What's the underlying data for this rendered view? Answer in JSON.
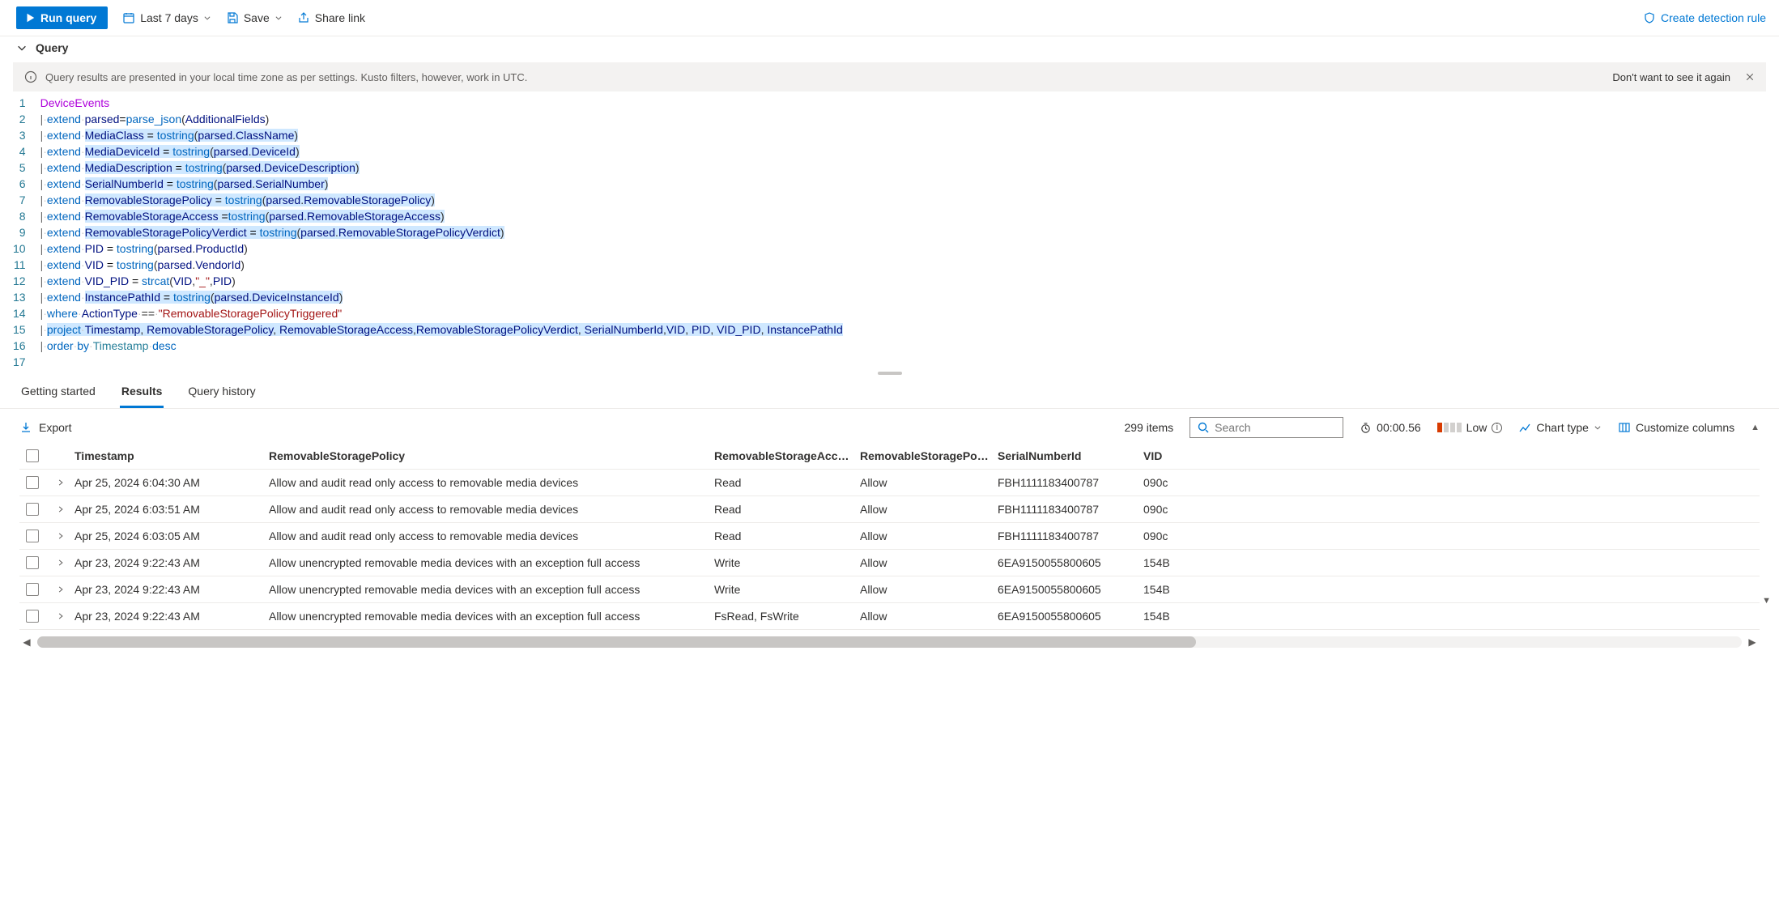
{
  "toolbar": {
    "run_label": "Run query",
    "time_label": "Last 7 days",
    "save_label": "Save",
    "share_label": "Share link",
    "create_rule_label": "Create detection rule"
  },
  "section": {
    "title": "Query"
  },
  "infobar": {
    "text": "Query results are presented in your local time zone as per settings. Kusto filters, however, work in UTC.",
    "dismiss": "Don't want to see it again"
  },
  "editor": {
    "lines": [
      {
        "n": "1",
        "raw": "DeviceEvents",
        "type": "ent"
      },
      {
        "n": "2",
        "raw": "| extend parsed=parse_json(AdditionalFields)"
      },
      {
        "n": "3",
        "raw": "| extend MediaClass = tostring(parsed.ClassName)"
      },
      {
        "n": "4",
        "raw": "| extend MediaDeviceId = tostring(parsed.DeviceId)"
      },
      {
        "n": "5",
        "raw": "| extend MediaDescription = tostring(parsed.DeviceDescription)"
      },
      {
        "n": "6",
        "raw": "| extend SerialNumberId = tostring(parsed.SerialNumber)"
      },
      {
        "n": "7",
        "raw": "| extend RemovableStoragePolicy = tostring(parsed.RemovableStoragePolicy)"
      },
      {
        "n": "8",
        "raw": "| extend RemovableStorageAccess =tostring(parsed.RemovableStorageAccess)"
      },
      {
        "n": "9",
        "raw": "| extend RemovableStoragePolicyVerdict = tostring(parsed.RemovableStoragePolicyVerdict)"
      },
      {
        "n": "10",
        "raw": "| extend PID = tostring(parsed.ProductId)"
      },
      {
        "n": "11",
        "raw": "| extend VID = tostring(parsed.VendorId)"
      },
      {
        "n": "12",
        "raw": "| extend VID_PID = strcat(VID,\"_\",PID)"
      },
      {
        "n": "13",
        "raw": "| extend InstancePathId = tostring(parsed.DeviceInstanceId)"
      },
      {
        "n": "14",
        "raw": "| where ActionType == \"RemovableStoragePolicyTriggered\""
      },
      {
        "n": "15",
        "raw": "| project Timestamp, RemovableStoragePolicy, RemovableStorageAccess,RemovableStoragePolicyVerdict, SerialNumberId,VID, PID, VID_PID, InstancePathId"
      },
      {
        "n": "16",
        "raw": "| order by Timestamp desc"
      },
      {
        "n": "17",
        "raw": ""
      }
    ]
  },
  "tabs": {
    "getting_started": "Getting started",
    "results": "Results",
    "history": "Query history"
  },
  "results": {
    "export": "Export",
    "count": "299 items",
    "search_placeholder": "Search",
    "duration": "00:00.56",
    "perf": "Low",
    "chart_type": "Chart type",
    "customize": "Customize columns",
    "columns": {
      "timestamp": "Timestamp",
      "policy": "RemovableStoragePolicy",
      "access": "RemovableStorageAccess",
      "verdict": "RemovableStoragePolicyVer...",
      "serial": "SerialNumberId",
      "vid": "VID"
    },
    "rows": [
      {
        "ts": "Apr 25, 2024 6:04:30 AM",
        "pol": "Allow and audit read only access to removable media devices",
        "acc": "Read",
        "ver": "Allow",
        "ser": "FBH1111183400787",
        "vid": "090c"
      },
      {
        "ts": "Apr 25, 2024 6:03:51 AM",
        "pol": "Allow and audit read only access to removable media devices",
        "acc": "Read",
        "ver": "Allow",
        "ser": "FBH1111183400787",
        "vid": "090c"
      },
      {
        "ts": "Apr 25, 2024 6:03:05 AM",
        "pol": "Allow and audit read only access to removable media devices",
        "acc": "Read",
        "ver": "Allow",
        "ser": "FBH1111183400787",
        "vid": "090c"
      },
      {
        "ts": "Apr 23, 2024 9:22:43 AM",
        "pol": "Allow unencrypted removable media devices with an exception full access",
        "acc": "Write",
        "ver": "Allow",
        "ser": "6EA9150055800605",
        "vid": "154B"
      },
      {
        "ts": "Apr 23, 2024 9:22:43 AM",
        "pol": "Allow unencrypted removable media devices with an exception full access",
        "acc": "Write",
        "ver": "Allow",
        "ser": "6EA9150055800605",
        "vid": "154B"
      },
      {
        "ts": "Apr 23, 2024 9:22:43 AM",
        "pol": "Allow unencrypted removable media devices with an exception full access",
        "acc": "FsRead, FsWrite",
        "ver": "Allow",
        "ser": "6EA9150055800605",
        "vid": "154B"
      }
    ]
  }
}
